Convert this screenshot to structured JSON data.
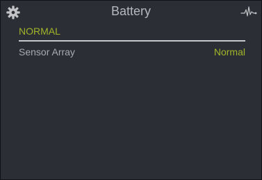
{
  "header": {
    "title": "Battery",
    "left_icon": "gear-icon",
    "right_icon": "pulse-icon"
  },
  "status": {
    "text": "NORMAL"
  },
  "rows": [
    {
      "label": "Sensor Array",
      "value": "Normal"
    }
  ],
  "colors": {
    "background": "#2b2e35",
    "accent": "#a2b528",
    "text": "#a9abb0",
    "title": "#b6b8bd",
    "divider": "#c8cacd"
  }
}
